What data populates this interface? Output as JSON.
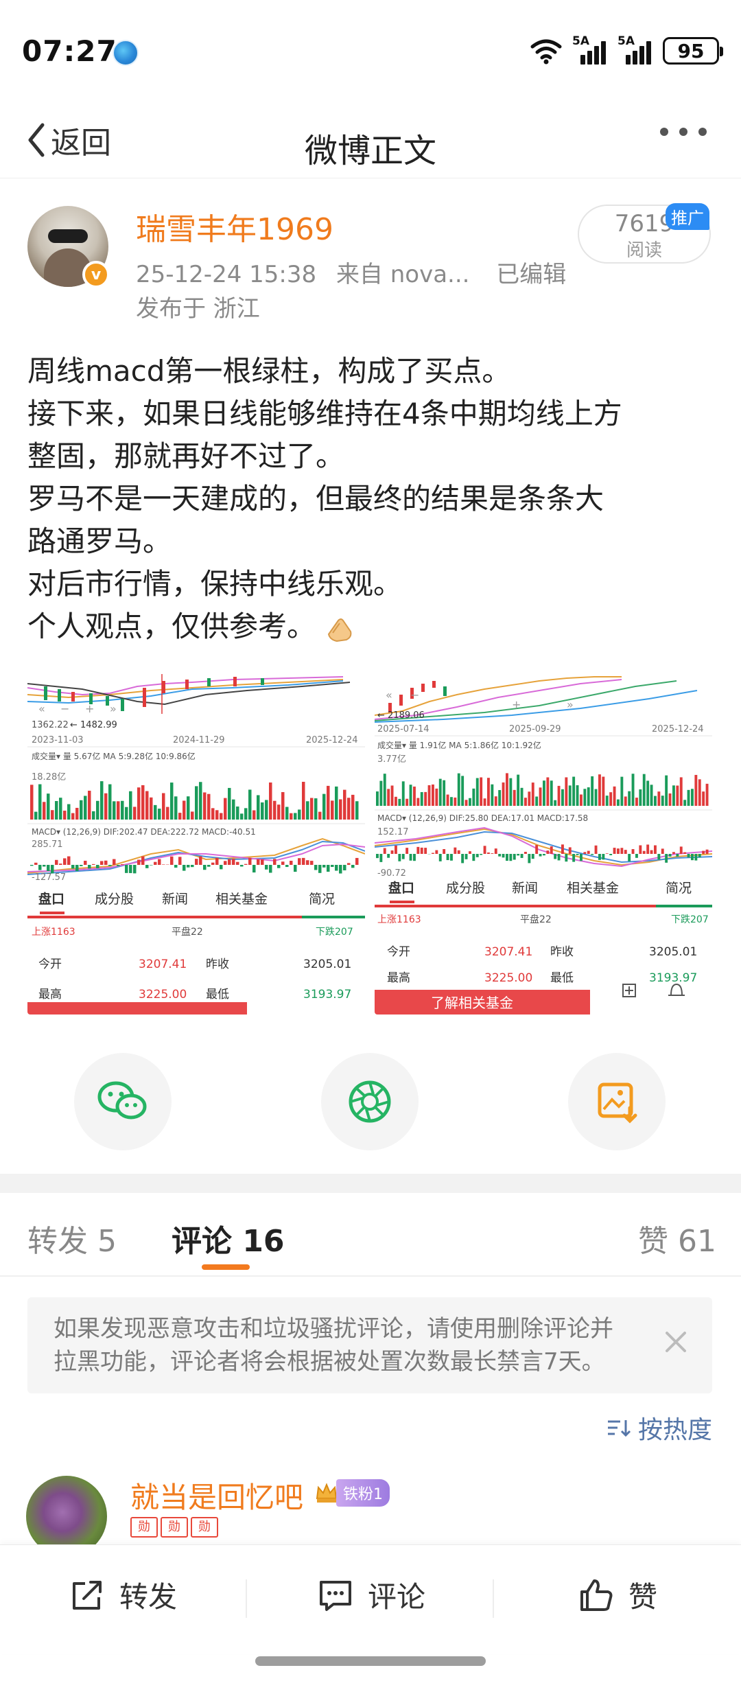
{
  "status_bar": {
    "time": "07:27",
    "network_1": "5A",
    "network_2": "5A",
    "battery": "95"
  },
  "nav": {
    "back_label": "返回",
    "title": "微博正文"
  },
  "post": {
    "author": "瑞雪丰年1969",
    "verified_mark": "v",
    "timestamp": "25-12-24 15:38",
    "source": "来自 nova...",
    "edited": "已编辑",
    "location": "发布于 浙江",
    "read_count": "7619",
    "read_label": "阅读",
    "promo_tag": "推广",
    "body_lines": [
      "周线macd第一根绿柱，构成了买点。",
      "接下来，如果日线能够维持在4条中期均线上方",
      "整固，那就再好不过了。",
      "罗马不是一天建成的，但最终的结果是条条大",
      "路通罗马。",
      "对后市行情，保持中线乐观。",
      "个人观点，仅供参考。"
    ]
  },
  "images": {
    "left": {
      "price_low": "1362.22",
      "price_mark": "1482.99",
      "dates": [
        "2023-11-03",
        "2024-11-29",
        "2025-12-24"
      ],
      "volume_label": "成交量▾ 量 5.67亿 MA 5:9.28亿 10:9.86亿",
      "volume_max": "18.28亿",
      "macd_label": "MACD▾ (12,26,9) DIF:202.47 DEA:222.72 MACD:-40.51",
      "macd_max": "285.71",
      "macd_min": "-127.57",
      "tabs": [
        "盘口",
        "成分股",
        "新闻",
        "相关基金",
        "简况"
      ],
      "breadth": [
        "上涨1163",
        "平盘22",
        "下跌207"
      ],
      "row1": [
        "今开",
        "3207.41",
        "昨收",
        "3205.01"
      ],
      "row2": [
        "最高",
        "3225.00",
        "最低",
        "3193.97"
      ]
    },
    "right": {
      "price_mark": "2189.06",
      "dates": [
        "2025-07-14",
        "2025-09-29",
        "2025-12-24"
      ],
      "volume_label": "成交量▾ 量 1.91亿 MA 5:1.86亿 10:1.92亿",
      "volume_max": "3.77亿",
      "macd_label": "MACD▾ (12,26,9) DIF:25.80 DEA:17.01 MACD:17.58",
      "macd_max": "152.17",
      "macd_min": "-90.72",
      "tabs": [
        "盘口",
        "成分股",
        "新闻",
        "相关基金",
        "简况"
      ],
      "breadth": [
        "上涨1163",
        "平盘22",
        "下跌207"
      ],
      "row1": [
        "今开",
        "3207.41",
        "昨收",
        "3205.01"
      ],
      "row2": [
        "最高",
        "3225.00",
        "最低",
        "3193.97"
      ],
      "cta": "了解相关基金"
    }
  },
  "tabs": {
    "repost": "转发 5",
    "comment": "评论 16",
    "like": "赞 61"
  },
  "notice": {
    "text": "如果发现恶意攻击和垃圾骚扰评论，请使用删除评论并拉黑功能，评论者将会根据被处置次数最长禁言7天。"
  },
  "sort": {
    "label": "按热度"
  },
  "comment": {
    "author": "就当是回忆吧",
    "fan_badge": "铁粉1",
    "medals": [
      "勋",
      "勋",
      "勋"
    ]
  },
  "actions": {
    "repost": "转发",
    "comment": "评论",
    "like": "赞"
  },
  "colors": {
    "accent_orange": "#f07b1d",
    "link_blue": "#5576a8",
    "promo_blue": "#2c8cf4",
    "stock_up_red": "#e03a3a",
    "stock_down_green": "#1a9b5a"
  }
}
